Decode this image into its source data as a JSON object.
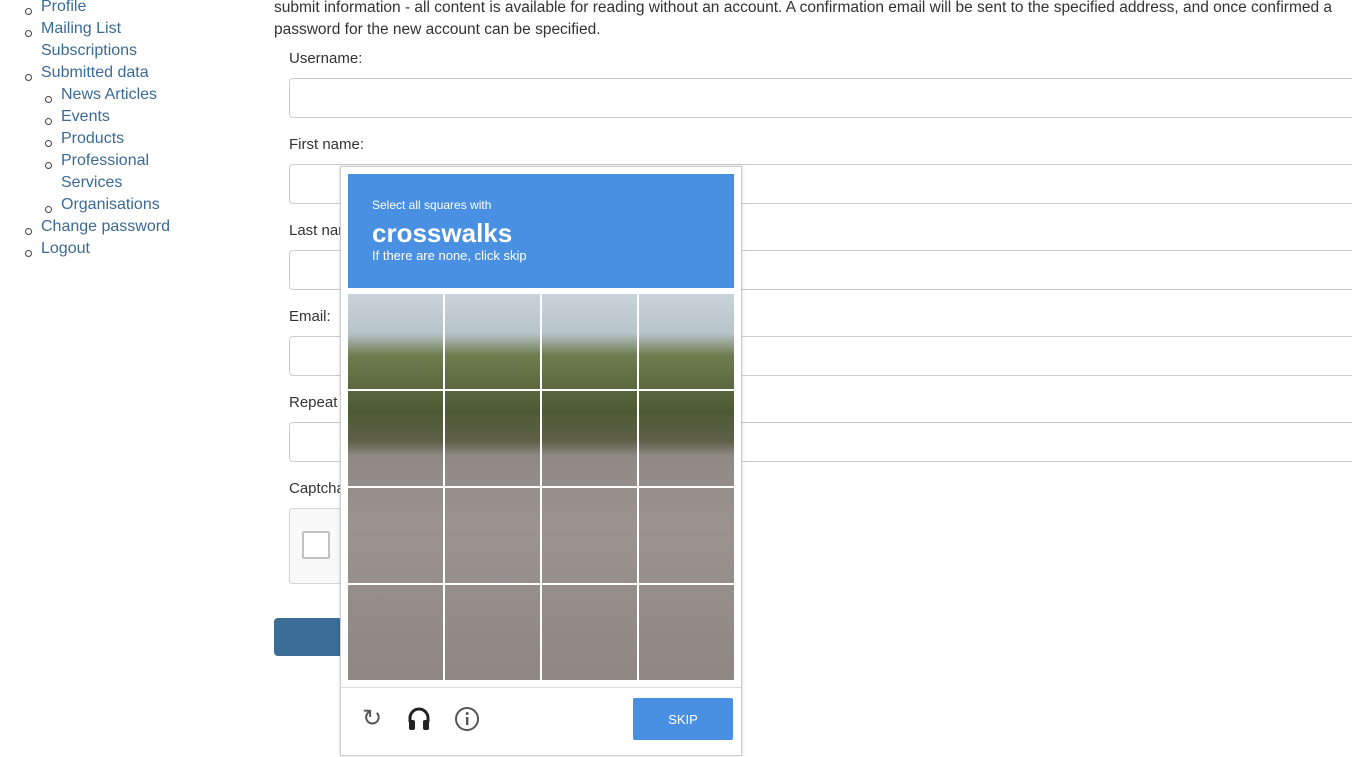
{
  "sidebar": {
    "items": [
      {
        "label": "Profile",
        "level": 1
      },
      {
        "label": "Mailing List Subscriptions",
        "level": 1
      },
      {
        "label": "Submitted data",
        "level": 1
      },
      {
        "label": "News Articles",
        "level": 2
      },
      {
        "label": "Events",
        "level": 2
      },
      {
        "label": "Products",
        "level": 2
      },
      {
        "label": "Professional Services",
        "level": 2
      },
      {
        "label": "Organisations",
        "level": 2
      },
      {
        "label": "Change password",
        "level": 1
      },
      {
        "label": "Logout",
        "level": 1
      }
    ]
  },
  "intro": "submit information - all content is available for reading without an account. A confirmation email will be sent to the specified address, and once confirmed a password for the new account can be specified.",
  "form": {
    "username_label": "Username:",
    "firstname_label": "First name:",
    "lastname_label": "Last name:",
    "email_label": "Email:",
    "repeat_label": "Repeat email:",
    "captcha_label": "Captcha:",
    "username": "",
    "firstname": "",
    "lastname": "",
    "email": "",
    "repeat": ""
  },
  "captcha": {
    "instruction": "Select all squares with",
    "target": "crosswalks",
    "hint": "If there are none, click skip",
    "skip_label": "SKIP",
    "icons": [
      "reload-icon",
      "headphones-icon",
      "info-icon"
    ],
    "accent": "#4a90e2"
  }
}
